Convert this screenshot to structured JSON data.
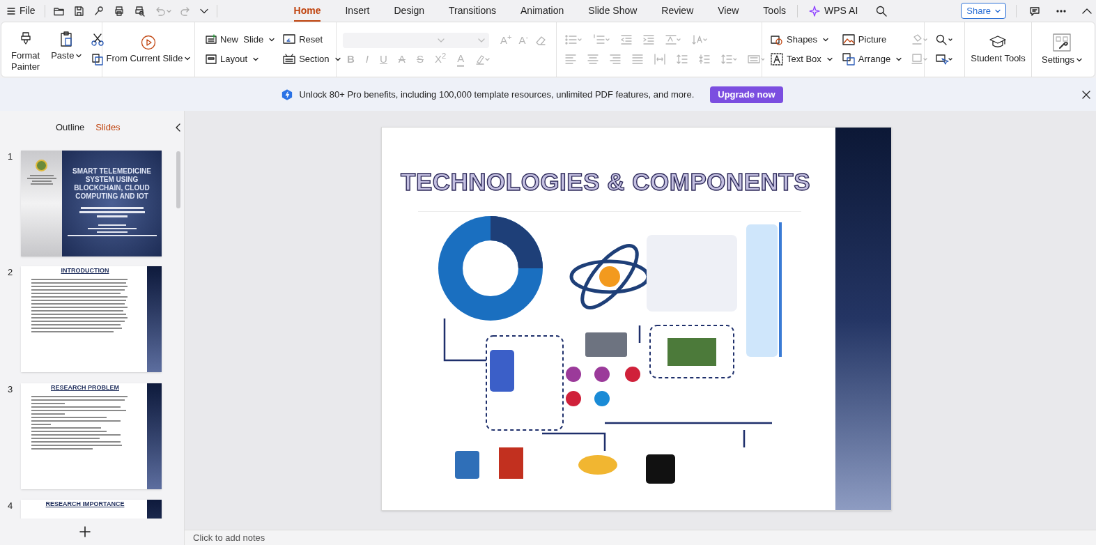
{
  "menu": {
    "file": "File"
  },
  "tabs": [
    {
      "label": "Home",
      "selected": true
    },
    {
      "label": "Insert",
      "selected": false
    },
    {
      "label": "Design",
      "selected": false
    },
    {
      "label": "Transitions",
      "selected": false
    },
    {
      "label": "Animation",
      "selected": false
    },
    {
      "label": "Slide Show",
      "selected": false
    },
    {
      "label": "Review",
      "selected": false
    },
    {
      "label": "View",
      "selected": false
    },
    {
      "label": "Tools",
      "selected": false
    }
  ],
  "ai_button": "WPS AI",
  "share_button": "Share",
  "ribbon": {
    "groups": [
      {
        "buttons": [
          {
            "label": "Format Painter",
            "dropdown": false
          },
          {
            "label": "Paste",
            "dropdown": true
          }
        ]
      },
      {
        "buttons": [
          {
            "label": "From Current Slide",
            "dropdown": true
          }
        ]
      },
      {
        "buttons": [
          {
            "label": "New  Slide",
            "dropdown": true
          },
          {
            "label": "Reset",
            "dropdown": false
          },
          {
            "label": "Layout",
            "dropdown": true
          },
          {
            "label": "Section",
            "dropdown": true
          }
        ]
      },
      {
        "buttons": [
          {
            "label": "Shapes",
            "dropdown": true
          },
          {
            "label": "Picture",
            "dropdown": false
          },
          {
            "label": "Text Box",
            "dropdown": true
          },
          {
            "label": "Arrange",
            "dropdown": true
          }
        ]
      },
      {
        "buttons": [
          {
            "label": "Student Tools",
            "dropdown": false
          }
        ]
      },
      {
        "buttons": [
          {
            "label": "Settings",
            "dropdown": true
          }
        ]
      }
    ],
    "font_buttons": [
      {
        "label": "A$^{+}$",
        "disabled": true
      },
      {
        "label": "A$^{-}$",
        "disabled": true
      }
    ],
    "format_buttons": [
      {
        "label": "B",
        "disabled": true
      },
      {
        "label": "I",
        "disabled": true
      },
      {
        "label": "U",
        "disabled": true
      },
      {
        "label": "A",
        "disabled": true
      },
      {
        "label": "S",
        "disabled": true
      },
      {
        "label": "X$^{2}$",
        "disabled": true
      },
      {
        "label": "A",
        "disabled": true
      }
    ]
  },
  "banner": {
    "text": "Unlock 80+ Pro benefits, including 100,000 template resources, unlimited PDF features, and more.",
    "button": "Upgrade now"
  },
  "panel_tabs": [
    {
      "label": "Outline",
      "selected": false
    },
    {
      "label": "Slides",
      "selected": true
    }
  ],
  "slides": [
    {
      "number": "1",
      "kind": "title",
      "title": "SMART TELEMEDICINE SYSTEM USING BLOCKCHAIN, CLOUD COMPUTING AND IOT"
    },
    {
      "number": "2",
      "kind": "bullets",
      "title": "INTRODUCTION"
    },
    {
      "number": "3",
      "kind": "bullets",
      "title": "RESEARCH PROBLEM"
    },
    {
      "number": "4",
      "kind": "partial",
      "title": "RESEARCH IMPORTANCE"
    }
  ],
  "current_slide": {
    "title": "TECHNOLOGIES & COMPONENTS"
  },
  "notes_placeholder": "Click to add notes"
}
